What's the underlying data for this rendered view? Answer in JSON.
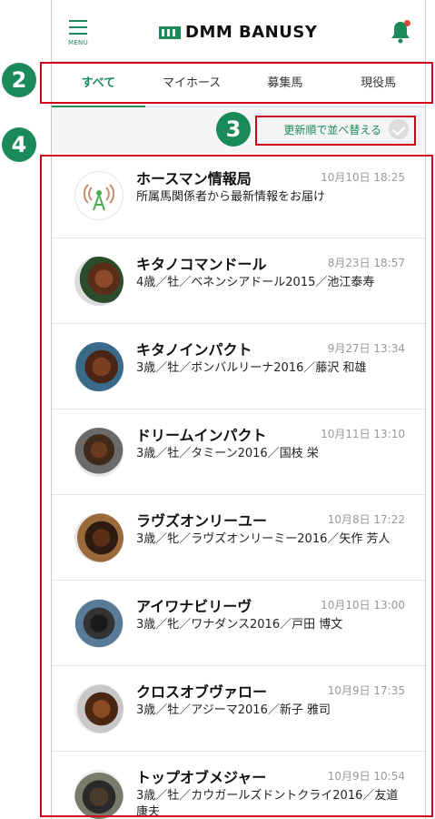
{
  "header": {
    "menu_label": "MENU",
    "logo_text": "DMM BANUSY"
  },
  "tabs": [
    {
      "label": "すべて"
    },
    {
      "label": "マイホース"
    },
    {
      "label": "募集馬"
    },
    {
      "label": "現役馬"
    }
  ],
  "sort": {
    "label": "更新順で並べ替える"
  },
  "annotations": {
    "tabs_num": "2",
    "sort_num": "3",
    "list_num": "4"
  },
  "items": [
    {
      "name": "ホースマン情報局",
      "time": "10月10日 18:25",
      "desc": "所属馬関係者から最新情報をお届け"
    },
    {
      "name": "キタノコマンドール",
      "time": "8月23日 18:57",
      "desc": "4歳／牡／ベネンシアドール2015／池江泰寿"
    },
    {
      "name": "キタノインパクト",
      "time": "9月27日 13:34",
      "desc": "3歳／牡／ボンバルリーナ2016／藤沢 和雄"
    },
    {
      "name": "ドリームインパクト",
      "time": "10月11日 13:10",
      "desc": "3歳／牡／タミーン2016／国枝 栄"
    },
    {
      "name": "ラヴズオンリーユー",
      "time": "10月8日 17:22",
      "desc": "3歳／牝／ラヴズオンリーミー2016／矢作 芳人"
    },
    {
      "name": "アイワナビリーヴ",
      "time": "10月10日 13:00",
      "desc": "3歳／牝／ワナダンス2016／戸田 博文"
    },
    {
      "name": "クロスオブヴァロー",
      "time": "10月9日 17:35",
      "desc": "3歳／牡／アジーマ2016／新子 雅司"
    },
    {
      "name": "トップオブメジャー",
      "time": "10月9日 10:54",
      "desc": "3歳／牡／カウガールズドントクライ2016／友道 康夫"
    }
  ],
  "colors": {
    "accent": "#1a8a5a",
    "annotation": "#d0021b"
  }
}
